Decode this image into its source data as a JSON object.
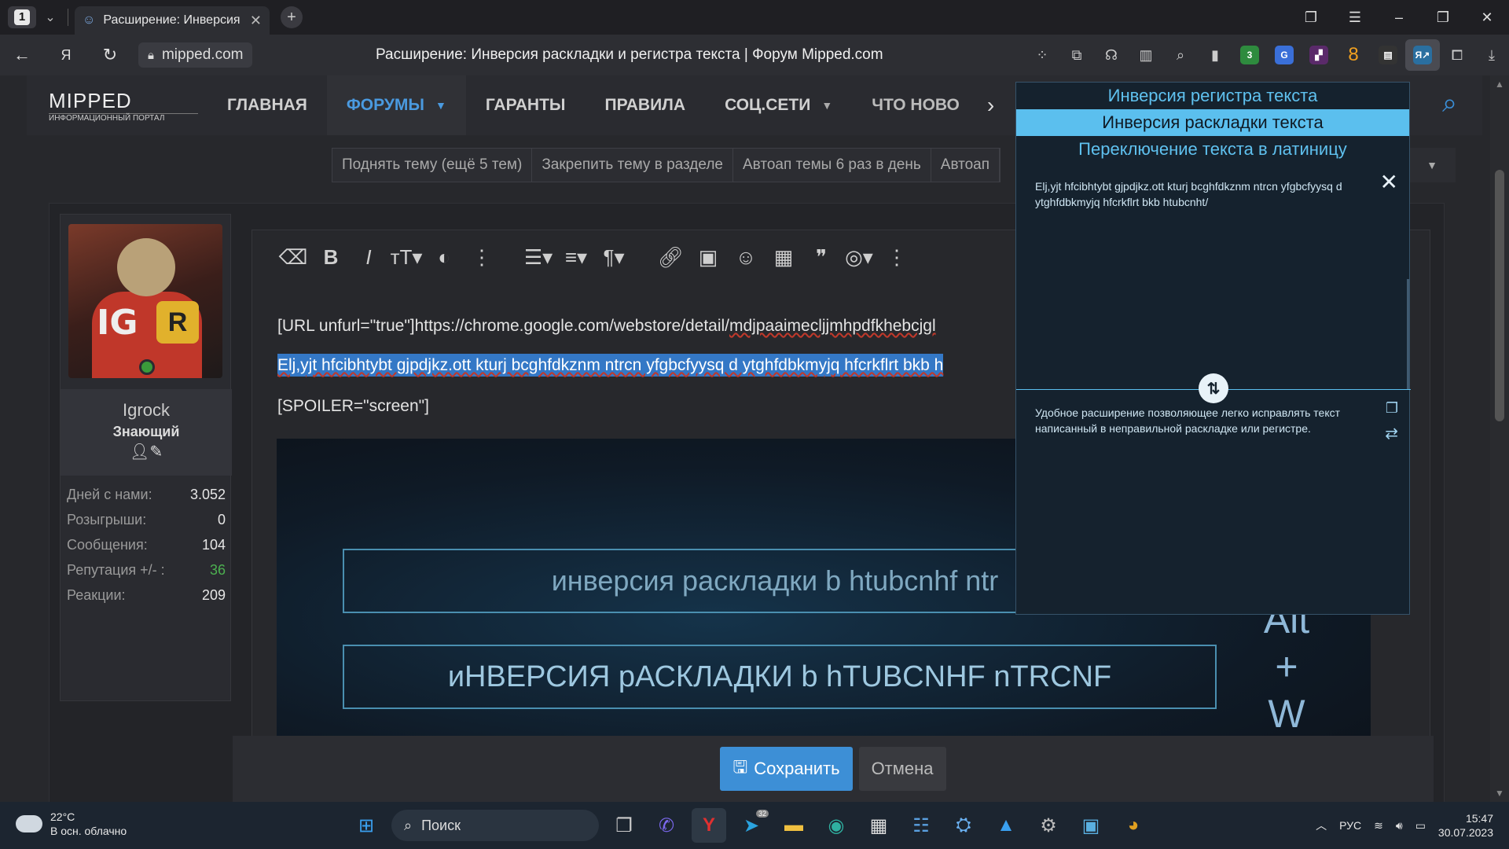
{
  "browser": {
    "tab_count": "1",
    "tab_title": "Расширение: Инверсия раскладки и регистра текста | Форум Mipped.com",
    "address": "mipped.com",
    "page_title": "Расширение: Инверсия раскладки и регистра текста | Форум Mipped.com",
    "ext_badge_3": "3"
  },
  "site": {
    "logo_main": "MIPPED",
    "logo_sub": "ИНФОРМАЦИОННЫЙ ПОРТАЛ",
    "nav": [
      "ГЛАВНАЯ",
      "ФОРУМЫ",
      "ГАРАНТЫ",
      "ПРАВИЛА",
      "СОЦ.СЕТИ",
      "ЧТО НОВО"
    ],
    "promos": [
      "Поднять тему (ещё 5 тем)",
      "Закрепить тему в разделе",
      "Автоап темы 6 раз в день",
      "Автоап"
    ]
  },
  "user": {
    "name": "Igrock",
    "title": "Знающий",
    "avatar_text_ig": "IG",
    "avatar_text_r": "R",
    "stats": [
      {
        "k": "Дней с нами:",
        "v": "3.052"
      },
      {
        "k": "Розыгрыши:",
        "v": "0"
      },
      {
        "k": "Сообщения:",
        "v": "104"
      },
      {
        "k": "Репутация +/- :",
        "v": "36"
      },
      {
        "k": "Реакции:",
        "v": "209"
      }
    ]
  },
  "editor": {
    "line1_prefix": "[URL unfurl=\"true\"]https://chrome.google.com/webstore/detail/",
    "line1_link": "mdjpaaimecljjmhpdfkhebcjgl",
    "line2_selected": "Elj,yjt hfcibhtybt gjpdjkz.ott kturj bcghfdkznm ntrcn yfgbcfyysq d ytghfdbkmyjq hfcrkflrt bkb h",
    "line3": "[SPOILER=\"screen\"]",
    "shot_box1": "инверсия раскладки b htubcnhf ntr",
    "shot_box2": "иНВЕРСИЯ рАСКЛАДКИ b hTUBCNHF nTRCNF",
    "shot_alt_1": "Alt",
    "shot_alt_2": "+",
    "shot_alt_3": "W",
    "save_label": "Сохранить",
    "cancel_label": "Отмена"
  },
  "popup": {
    "modes": [
      "Инверсия регистра текста",
      "Инверсия раскладки текста",
      "Переключение текста в латиницу"
    ],
    "active_mode_index": 1,
    "input_text": "Elj,yjt hfcibhtybt gjpdjkz.ott kturj bcghfdkznm ntrcn yfgbcfyysq d ytghfdbkmyjq hfcrkflrt bkb htubcnht/",
    "output_text": "Удобное расширение позволяющее легко исправлять текст написанный в неправильной раскладке или регистре."
  },
  "taskbar": {
    "temp": "22°C",
    "weather": "В осн. облачно",
    "search_label": "Поиск",
    "telegram_badge": "32",
    "lang": "РУС",
    "time": "15:47",
    "date": "30.07.2023"
  },
  "colors": {
    "accent_blue": "#3d8fd6",
    "popup_accent": "#5bbfee",
    "reputation_green": "#4caf50"
  }
}
